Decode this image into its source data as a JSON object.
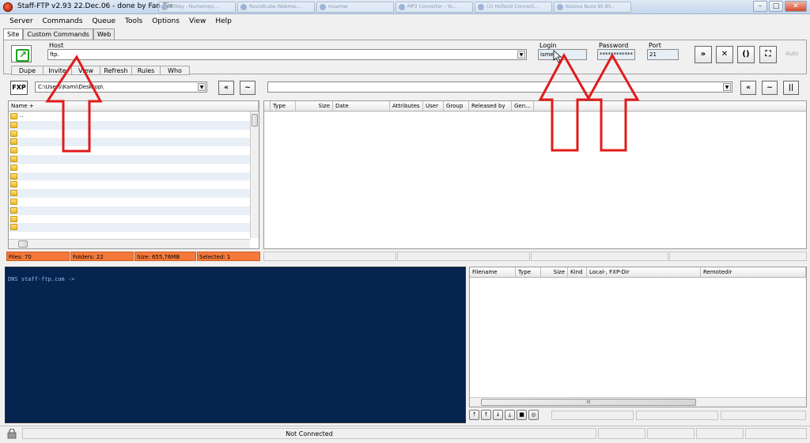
{
  "window": {
    "title": "Staff-FTP v2.93 22.Dec.06 - done by Fan Tie",
    "background_tabs": [
      "Bilkey - Numeroqu...",
      "Roundcube Webmai...",
      "muamer",
      "MP3 Converter - Yo...",
      "(2) Holland Connect...",
      "Kosova Nuos 95 BY..."
    ],
    "controls": {
      "minimize": "–",
      "maximize": "□",
      "close": "✕"
    }
  },
  "menu": [
    "Server",
    "Commands",
    "Queue",
    "Tools",
    "Options",
    "View",
    "Help"
  ],
  "site_tabs": [
    "Site",
    "Custom Commands",
    "Web"
  ],
  "connection": {
    "host_label": "Host",
    "host_value": "ftp.",
    "login_label": "Login",
    "login_value": "ismet",
    "password_label": "Password",
    "password_value": "************",
    "port_label": "Port",
    "port_value": "21",
    "auto_label": "Auto"
  },
  "toolbar_right": [
    {
      "name": "transfer-forward-button",
      "glyph": "»"
    },
    {
      "name": "disconnect-button",
      "glyph": "✕"
    },
    {
      "name": "reconnect-button",
      "glyph": "()"
    },
    {
      "name": "fullscreen-button",
      "glyph": "⛶"
    }
  ],
  "subtabs": [
    "Dupe",
    "Invite",
    "View",
    "Refresh",
    "Rules",
    "Who"
  ],
  "local": {
    "fxp_label": "FXP",
    "path": "C:\\Users\\Kami\\Desktop\\",
    "column_name": "Name +",
    "first_row": "..",
    "folder_rows": 14
  },
  "remote": {
    "path": "",
    "columns": [
      "Type",
      "Size",
      "Date",
      "Attributes",
      "User",
      "Group",
      "Released by",
      "Gen..."
    ]
  },
  "local_status": {
    "files": "Files: 70",
    "folders": "Folders: 22",
    "size": "Size: 655,76MB",
    "selected": "Selected: 1"
  },
  "console": {
    "line": "DNS staff-ftp.com ->"
  },
  "queue": {
    "columns": [
      "Filename",
      "Type",
      "Size",
      "Kind",
      "Local-, FXP-Dir",
      "Remotedir"
    ],
    "hscroll_grip": "III"
  },
  "status_bar": {
    "text": "Not Connected"
  },
  "colors": {
    "status_orange": "#f47a3b",
    "console_bg": "#052450",
    "annotation_red": "#e11b1b",
    "title_gradient": "#c4d6ec"
  }
}
